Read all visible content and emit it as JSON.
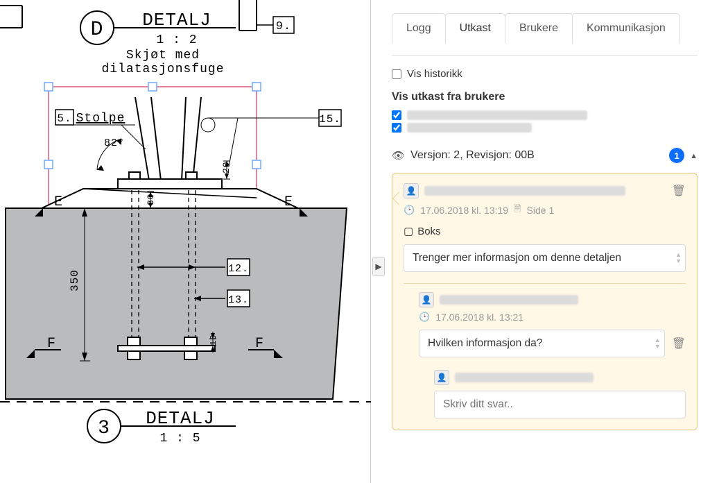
{
  "drawing": {
    "title_upper_letter": "D",
    "title_upper": "DETALJ",
    "scale_upper": "1 : 2",
    "subtitle1": "Skjøt med",
    "subtitle2": "dilatasjonsfuge",
    "label_stolpe": "Stolpe",
    "angle": "82°",
    "dim_20": "20",
    "dim_30": "30",
    "dim_10": "10",
    "dim_350": "350",
    "marker_E": "E",
    "marker_F": "F",
    "callout_5": "5.",
    "callout_9": "9.",
    "callout_12": "12.",
    "callout_13": "13.",
    "callout_15": "15.",
    "title_lower_letter": "3",
    "title_lower": "DETALJ",
    "scale_lower": "1 : 5"
  },
  "tabs": {
    "logg": "Logg",
    "utkast": "Utkast",
    "brukere": "Brukere",
    "kommunikasjon": "Kommunikasjon"
  },
  "panel": {
    "show_history": "Vis historikk",
    "from_users_heading": "Vis utkast fra brukere",
    "version_line": "Versjon: 2, Revisjon: 00B",
    "badge_count": "1"
  },
  "thread": {
    "timestamp": "17.06.2018 kl. 13:19",
    "page": "Side 1",
    "boks": "Boks",
    "comment": "Trenger mer informasjon om denne detaljen",
    "reply_timestamp": "17.06.2018 kl. 13:21",
    "reply_text": "Hvilken informasjon da?",
    "reply_placeholder": "Skriv ditt svar.."
  }
}
